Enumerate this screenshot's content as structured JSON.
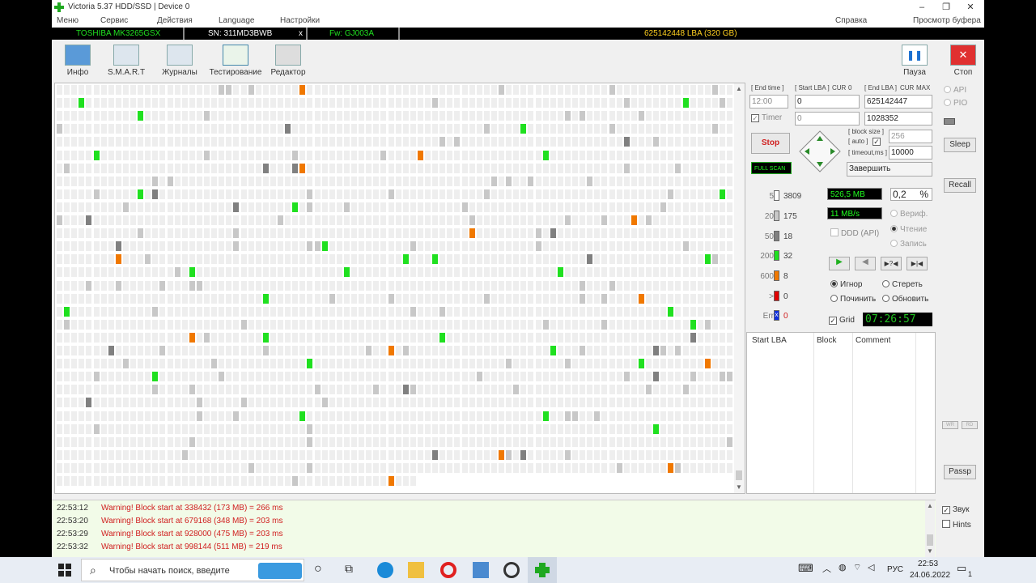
{
  "window": {
    "title": "Victoria 5.37 HDD/SSD | Device 0",
    "minimize": "–",
    "maximize": "❐",
    "close": "✕"
  },
  "menu": {
    "items": [
      "Меню",
      "Сервис",
      "Действия",
      "Language",
      "Настройки"
    ],
    "help": "Справка",
    "buffer": "Просмотр буфера"
  },
  "drive": {
    "model": "TOSHIBA MK3265GSX",
    "serial": "SN: 311MD3BWB",
    "close": "x",
    "firmware": "Fw: GJ003A",
    "capacity": "625142448 LBA (320 GB)"
  },
  "toolbar": {
    "info": "Инфо",
    "smart": "S.M.A.R.T",
    "logs": "Журналы",
    "test": "Тестирование",
    "editor": "Редактор",
    "pause": "Пауза",
    "stop": "Стоп"
  },
  "scan": {
    "end_time_label": "[ End time ]",
    "start_lba_label": "[ Start LBA ]",
    "cur_label": "CUR",
    "zero_label": "0",
    "end_lba_label": "[ End LBA ]",
    "max_label": "MAX",
    "end_time": "12:00",
    "start_lba": "0",
    "end_lba": "625142447",
    "timer_label": "Timer",
    "timer_value": "0",
    "position": "1028352",
    "stop_button": "Stop",
    "block_size_label": "[ block size ]",
    "auto_label": "[ auto ]",
    "timeout_label": "[ timeout,ms ]",
    "block_size": "256",
    "timeout": "10000",
    "full_scan": "FULL SCAN",
    "finish_action": "Завершить"
  },
  "legend": [
    {
      "label": "5",
      "count": "3809",
      "color": "#ffffff"
    },
    {
      "label": "20",
      "count": "175",
      "color": "#c8c8c8"
    },
    {
      "label": "50",
      "count": "18",
      "color": "#808080"
    },
    {
      "label": "200",
      "count": "32",
      "color": "#20e020"
    },
    {
      "label": "600",
      "count": "8",
      "color": "#f07800"
    },
    {
      "label": ">",
      "count": "0",
      "color": "#e00000"
    },
    {
      "label": "Err",
      "count": "0",
      "color": "#1030e0"
    }
  ],
  "stats": {
    "done": "526,5 MB",
    "percent": "0,2",
    "percent_sign": "%",
    "speed": "11 MB/s",
    "ddd": "DDD (API)",
    "verify": "Вериф.",
    "read": "Чтение",
    "write": "Запись"
  },
  "actions": {
    "ignore": "Игнор",
    "erase": "Стереть",
    "repair": "Починить",
    "refresh": "Обновить",
    "grid": "Grid",
    "clock": "07:26:57"
  },
  "results": {
    "col_start": "Start LBA",
    "col_block": "Block",
    "col_comment": "Comment"
  },
  "right": {
    "api": "API",
    "pio": "PIO",
    "sleep": "Sleep",
    "recall": "Recall",
    "wr": "WR",
    "rd": "RD",
    "passport": "Passp",
    "sound": "Звук",
    "hints": "Hints"
  },
  "log": [
    {
      "time": "22:53:12",
      "msg": "Warning! Block start at 338432 (173 MB)  = 266 ms"
    },
    {
      "time": "22:53:20",
      "msg": "Warning! Block start at 679168 (348 MB)  = 203 ms"
    },
    {
      "time": "22:53:29",
      "msg": "Warning! Block start at 928000 (475 MB)  = 203 ms"
    },
    {
      "time": "22:53:32",
      "msg": "Warning! Block start at 998144 (511 MB)  = 219 ms"
    }
  ],
  "taskbar": {
    "search": "Чтобы начать поиск, введите",
    "lang": "РУС",
    "time": "22:53",
    "date": "24.06.2022",
    "notif": "1"
  },
  "colors": {
    "white": "#ffffff",
    "light": "#c8c8c8",
    "dark": "#808080",
    "green": "#20e020",
    "orange": "#f07800"
  }
}
